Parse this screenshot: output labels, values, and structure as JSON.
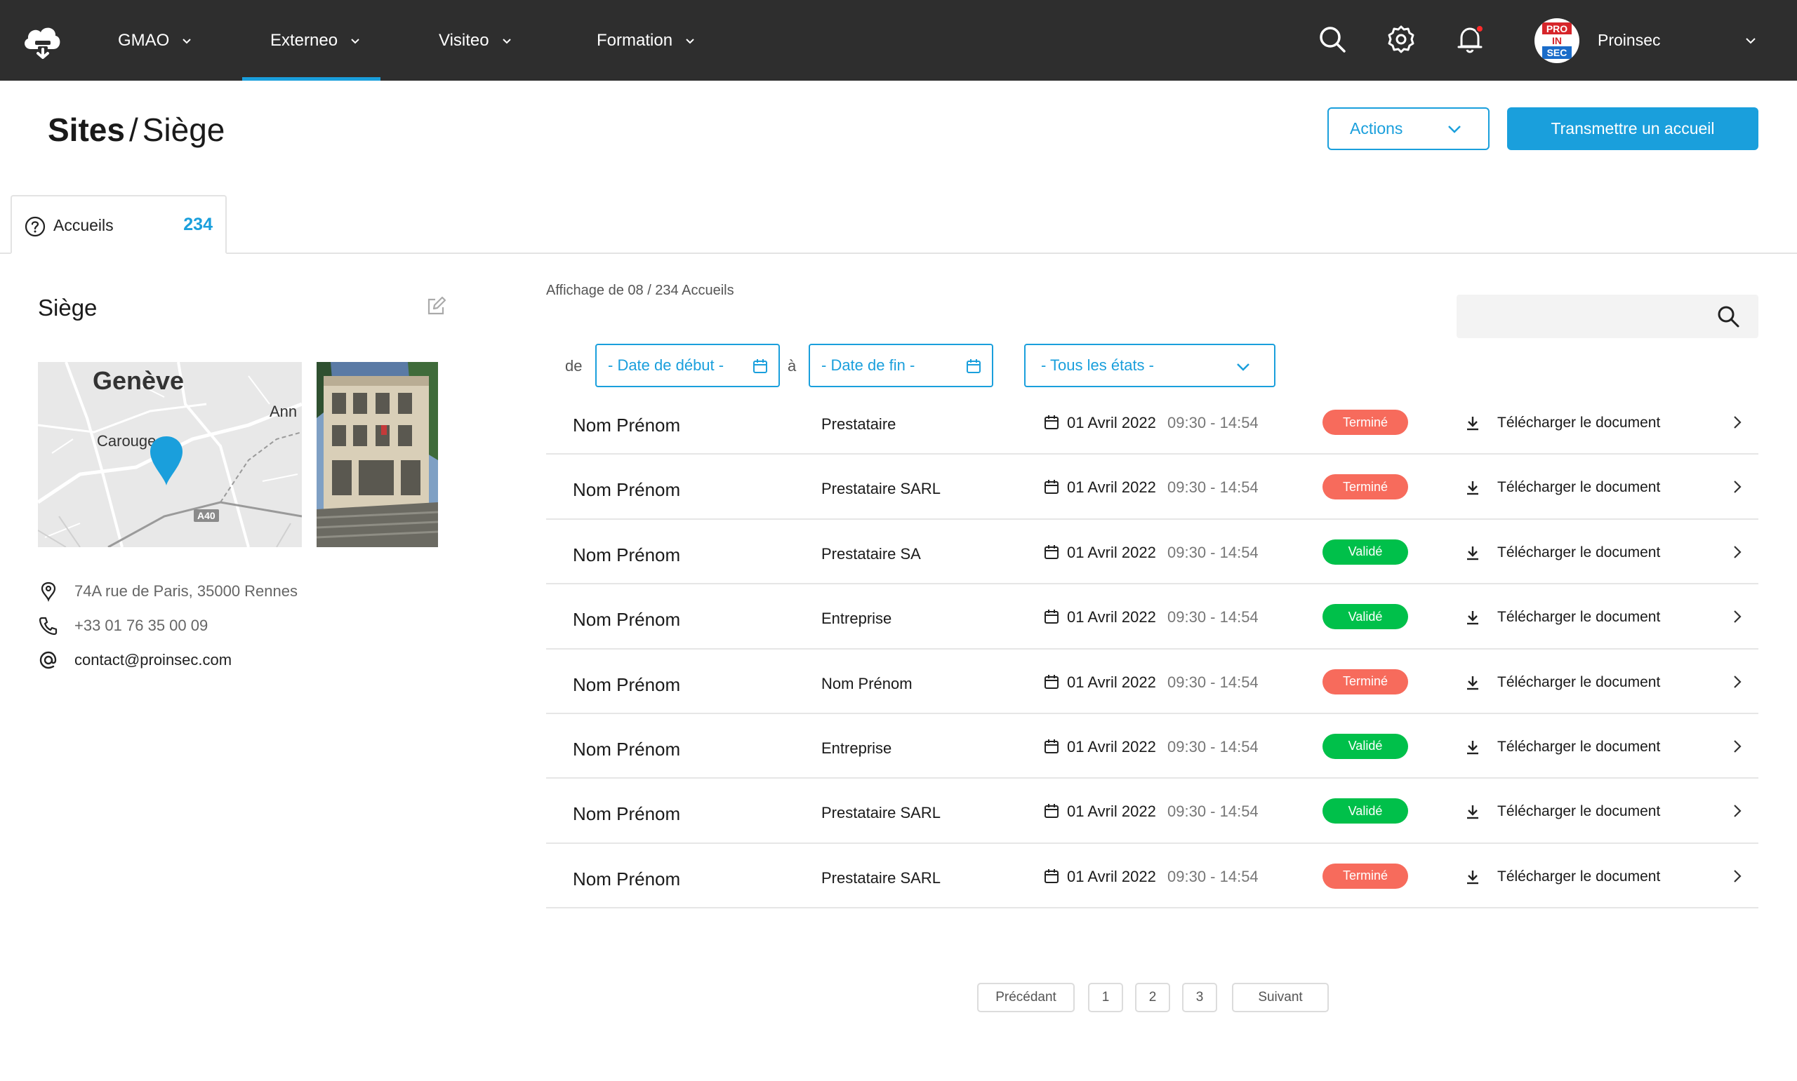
{
  "nav": {
    "items": [
      {
        "label": "GMAO",
        "active": false
      },
      {
        "label": "Externeo",
        "active": true
      },
      {
        "label": "Visiteo",
        "active": false
      },
      {
        "label": "Formation",
        "active": false
      }
    ],
    "user_name": "Proinsec",
    "avatar_logo_lines": [
      "PRO",
      "IN",
      "SEC"
    ],
    "icons": [
      "search-icon",
      "gear-icon",
      "bell-icon"
    ]
  },
  "header": {
    "breadcrumb_root": "Sites",
    "breadcrumb_sep": "/",
    "breadcrumb_current": "Siège",
    "actions_label": "Actions",
    "primary_label": "Transmettre un accueil"
  },
  "tabs": [
    {
      "label": "Accueils",
      "count": "234"
    }
  ],
  "site": {
    "name": "Siège",
    "map_labels": {
      "city": "Genève",
      "suburb": "Carouge",
      "partial": "Ann",
      "road": "A40"
    },
    "address": "74A rue de Paris, 35000 Rennes",
    "phone": "+33 01 76 35 00 09",
    "email": "contact@proinsec.com"
  },
  "list": {
    "display_count": "Affichage de 08 / 234 Accueils",
    "search_placeholder": "",
    "filter_from": "de",
    "filter_to": "à",
    "date_start": "- Date de début -",
    "date_end": "- Date de fin -",
    "state": "- Tous les états -"
  },
  "status_colors": {
    "Terminé": "#f76b5c",
    "Validé": "#00c04a"
  },
  "rows": [
    {
      "name": "Nom Prénom",
      "company": "Prestataire",
      "date": "01 Avril 2022",
      "time": "09:30 - 14:54",
      "status": "Terminé",
      "download": "Télécharger le document"
    },
    {
      "name": "Nom Prénom",
      "company": "Prestataire SARL",
      "date": "01 Avril 2022",
      "time": "09:30 - 14:54",
      "status": "Terminé",
      "download": "Télécharger le document"
    },
    {
      "name": "Nom Prénom",
      "company": "Prestataire SA",
      "date": "01 Avril 2022",
      "time": "09:30 - 14:54",
      "status": "Validé",
      "download": "Télécharger le document"
    },
    {
      "name": "Nom Prénom",
      "company": "Entreprise",
      "date": "01 Avril 2022",
      "time": "09:30 - 14:54",
      "status": "Validé",
      "download": "Télécharger le document"
    },
    {
      "name": "Nom Prénom",
      "company": "Nom Prénom",
      "date": "01 Avril 2022",
      "time": "09:30 - 14:54",
      "status": "Terminé",
      "download": "Télécharger le document"
    },
    {
      "name": "Nom Prénom",
      "company": "Entreprise",
      "date": "01 Avril 2022",
      "time": "09:30 - 14:54",
      "status": "Validé",
      "download": "Télécharger le document"
    },
    {
      "name": "Nom Prénom",
      "company": "Prestataire SARL",
      "date": "01 Avril 2022",
      "time": "09:30 - 14:54",
      "status": "Validé",
      "download": "Télécharger le document"
    },
    {
      "name": "Nom Prénom",
      "company": "Prestataire SARL",
      "date": "01 Avril 2022",
      "time": "09:30 - 14:54",
      "status": "Terminé",
      "download": "Télécharger le document"
    }
  ],
  "pagination": {
    "prev": "Précédant",
    "pages": [
      "1",
      "2",
      "3"
    ],
    "next": "Suivant"
  }
}
